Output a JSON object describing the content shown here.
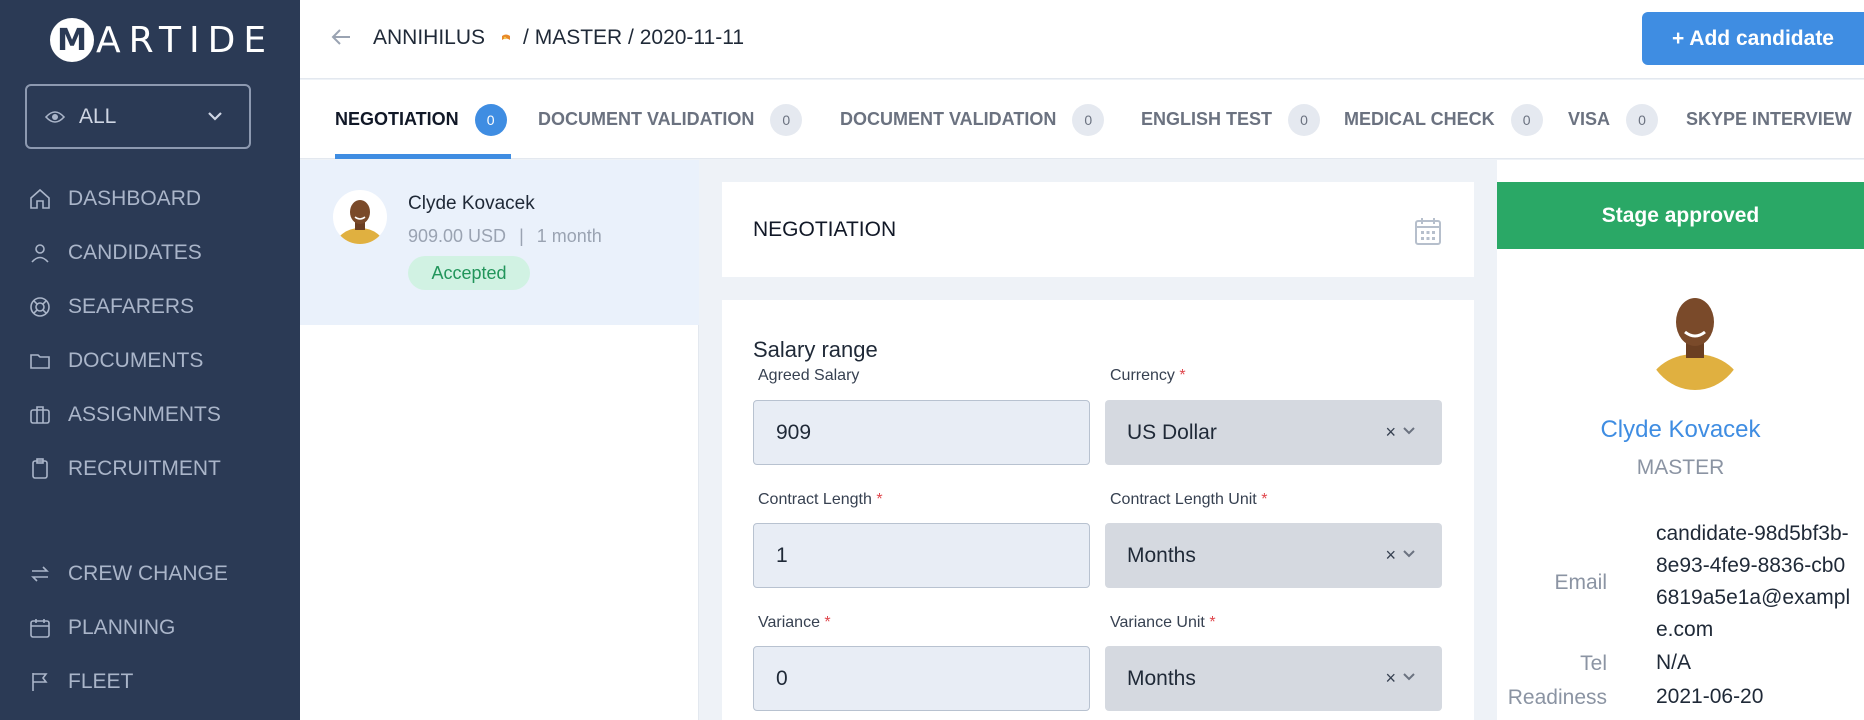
{
  "app": {
    "logo_letter": "M",
    "logo_text": "ARTIDE"
  },
  "sidebar": {
    "filter": {
      "value": "ALL"
    },
    "items": [
      {
        "label": "DASHBOARD",
        "icon": "home-icon"
      },
      {
        "label": "CANDIDATES",
        "icon": "user-icon"
      },
      {
        "label": "SEAFARERS",
        "icon": "lifebuoy-icon"
      },
      {
        "label": "DOCUMENTS",
        "icon": "folder-icon"
      },
      {
        "label": "ASSIGNMENTS",
        "icon": "briefcase-icon"
      },
      {
        "label": "RECRUITMENT",
        "icon": "clipboard-icon"
      },
      {
        "label": "CREW CHANGE",
        "icon": "swap-icon"
      },
      {
        "label": "PLANNING",
        "icon": "calendar-icon"
      },
      {
        "label": "FLEET",
        "icon": "flag-icon"
      }
    ]
  },
  "header": {
    "vessel": "ANNIHILUS",
    "path": "/ MASTER / 2020-11-11",
    "add_button": "+ Add candidate"
  },
  "tabs": [
    {
      "label": "NEGOTIATION",
      "count": "0",
      "active": true
    },
    {
      "label": "DOCUMENT VALIDATION",
      "count": "0"
    },
    {
      "label": "DOCUMENT VALIDATION",
      "count": "0"
    },
    {
      "label": "ENGLISH TEST",
      "count": "0"
    },
    {
      "label": "MEDICAL CHECK",
      "count": "0"
    },
    {
      "label": "VISA",
      "count": "0"
    },
    {
      "label": "SKYPE INTERVIEW",
      "count": ""
    }
  ],
  "candidate_list": [
    {
      "name": "Clyde Kovacek",
      "salary": "909.00 USD",
      "separator": "|",
      "duration": "1 month",
      "status": "Accepted"
    }
  ],
  "stage": {
    "title": "NEGOTIATION"
  },
  "form": {
    "section_title": "Salary range",
    "agreed_salary": {
      "label": "Agreed Salary",
      "value": "909"
    },
    "currency": {
      "label": "Currency",
      "value": "US Dollar",
      "required": "*"
    },
    "contract_length": {
      "label": "Contract Length",
      "value": "1",
      "required": "*"
    },
    "contract_length_unit": {
      "label": "Contract Length Unit",
      "value": "Months",
      "required": "*"
    },
    "variance": {
      "label": "Variance",
      "value": "0",
      "required": "*"
    },
    "variance_unit": {
      "label": "Variance Unit",
      "value": "Months",
      "required": "*"
    },
    "clear_symbol": "×"
  },
  "profile": {
    "approved_label": "Stage approved",
    "name": "Clyde Kovacek",
    "rank": "MASTER",
    "email_label": "Email",
    "email": "candidate-98d5bf3b-8e93-4fe9-8836-cb06819a5e1a@example.com",
    "tel_label": "Tel",
    "tel": "N/A",
    "readiness_label": "Readiness",
    "readiness": "2021-06-20"
  },
  "colors": {
    "sidebar_bg": "#2b3a55",
    "accent": "#3f8de2",
    "approved": "#2aa866",
    "status_bg": "#d1f2e3"
  }
}
